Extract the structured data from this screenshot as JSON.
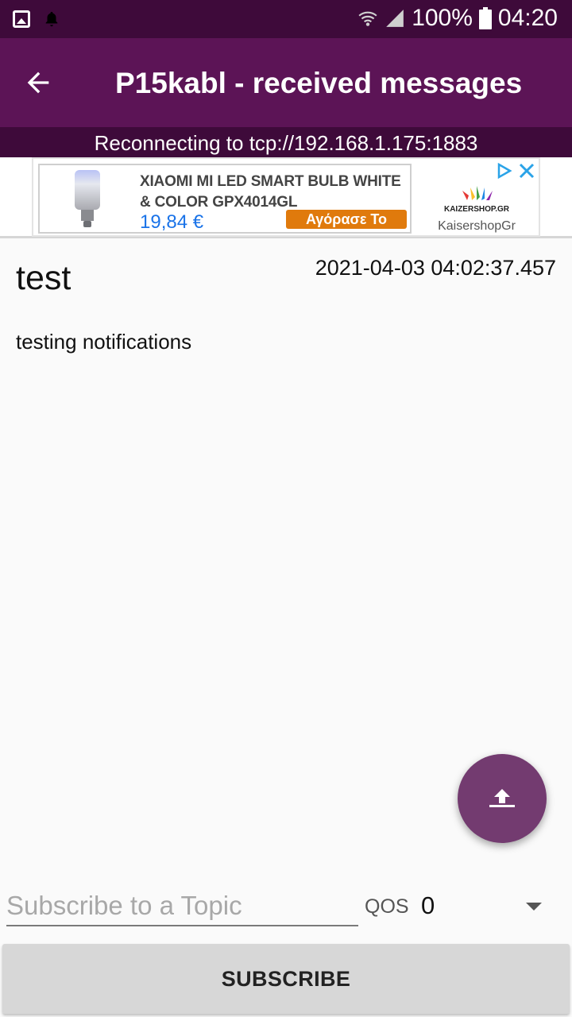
{
  "status_bar": {
    "battery_percent": "100%",
    "time": "04:20",
    "icons": [
      "image-icon",
      "notification-bell-icon",
      "wifi-icon",
      "signal-icon",
      "battery-icon"
    ]
  },
  "app_bar": {
    "title": "P15kabl - received messages",
    "back_icon": "arrow-back-icon"
  },
  "connection_banner": "Reconnecting to tcp://192.168.1.175:1883",
  "ad": {
    "product_name": "XIAOMI MI LED SMART BULB WHITE & COLOR GPX4014GL",
    "price": "19,84 €",
    "buy_label": "Αγόρασε Το",
    "advertiser_name": "KaisershopGr",
    "logo_text": "KAIZERSHOP.GR",
    "accent_color": "#e07a0c"
  },
  "messages": [
    {
      "topic": "test",
      "timestamp": "2021-04-03 04:02:37.457",
      "body": "testing notifications"
    }
  ],
  "fab": {
    "icon": "publish-icon",
    "color": "#733b70"
  },
  "subscribe_form": {
    "topic_placeholder": "Subscribe to a Topic",
    "topic_value": "",
    "qos_label": "QOS",
    "qos_value": "0",
    "button_label": "SUBSCRIBE"
  },
  "colors": {
    "status_bar": "#3e0a3a",
    "app_bar": "#5c1456",
    "background": "#fafafa"
  }
}
